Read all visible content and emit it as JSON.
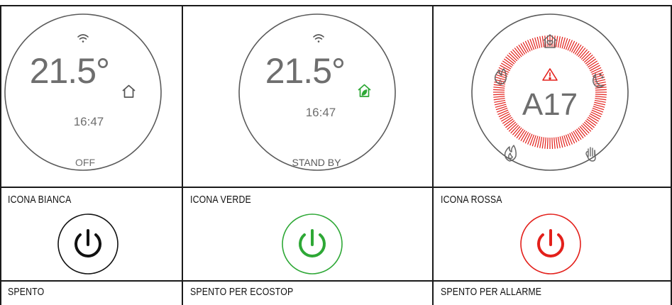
{
  "panels": [
    {
      "display": {
        "temperature": "21.5°",
        "time": "16:47",
        "status": "OFF",
        "wifi_icon": "wifi-icon",
        "home_icon": "home-icon",
        "home_icon_color": "#555555"
      },
      "icon_caption": "ICONA BIANCA",
      "power_button": {
        "icon": "power-icon",
        "color": "#111111"
      },
      "state_caption": "SPENTO"
    },
    {
      "display": {
        "temperature": "21.5°",
        "time": "16:47",
        "status": "STAND BY",
        "wifi_icon": "wifi-icon",
        "home_icon": "eco-home-icon",
        "home_icon_color": "#2ea836"
      },
      "icon_caption": "ICONA VERDE",
      "power_button": {
        "icon": "power-icon",
        "color": "#2ea836"
      },
      "state_caption": "SPENTO PER ECOSTOP"
    },
    {
      "display": {
        "alarm_code": "A17",
        "icons": [
          "home-heart-icon",
          "auto-flame-icon",
          "night-mode-icon",
          "flame-icon",
          "manual-hand-icon",
          "warning-icon"
        ]
      },
      "icon_caption": "ICONA ROSSA",
      "power_button": {
        "icon": "power-icon",
        "color": "#e3201b"
      },
      "state_caption": "SPENTO PER ALLARME"
    }
  ],
  "colors": {
    "grid_line": "#1a1a1a",
    "display_text": "#6e6e6e",
    "alarm_red": "#e3201b",
    "eco_green": "#2ea836"
  }
}
